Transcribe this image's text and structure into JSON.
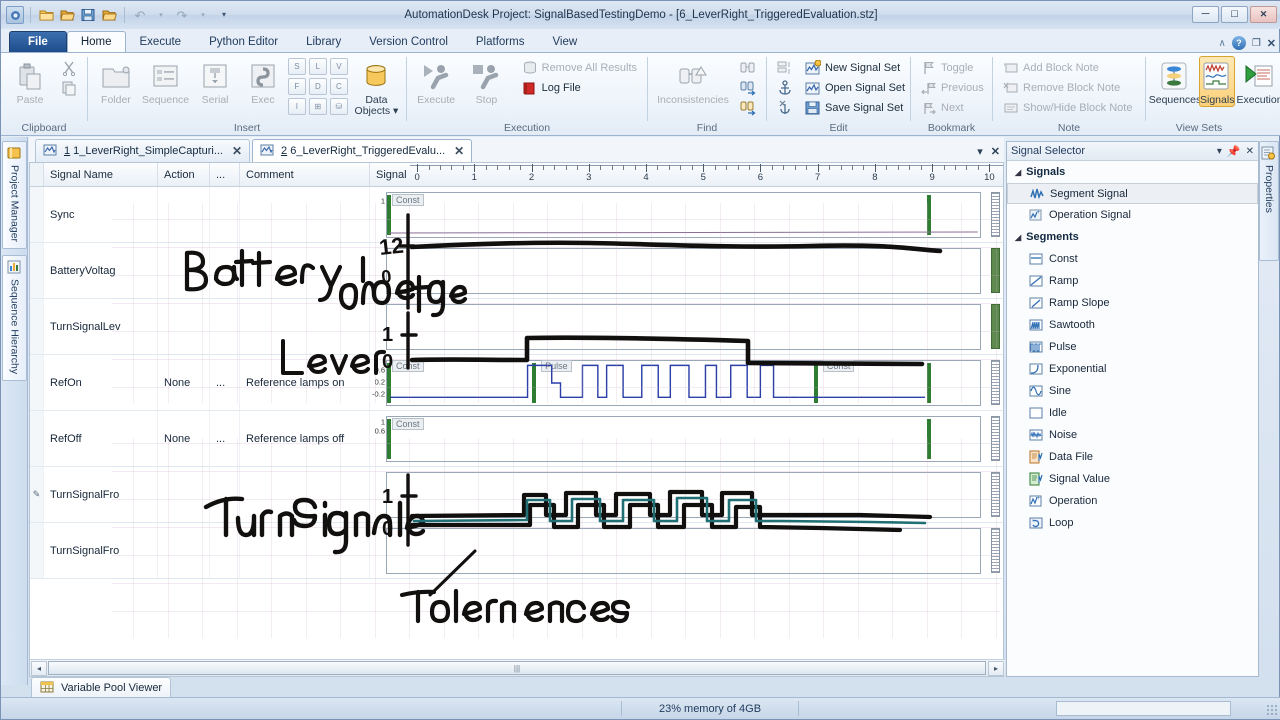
{
  "window": {
    "title": "AutomationDesk  Project: SignalBasedTestingDemo - [6_LeverRight_TriggeredEvaluation.stz]",
    "minimize": "—",
    "maximize": "□",
    "close": "✕"
  },
  "quick_access": {
    "items": [
      {
        "name": "app-menu-icon",
        "glyph": "⚙"
      },
      {
        "name": "new-project-icon",
        "glyph": "🖿"
      },
      {
        "name": "open-project-icon",
        "glyph": "📂"
      },
      {
        "name": "save-icon",
        "glyph": "💾"
      },
      {
        "name": "open-recent-icon",
        "glyph": "📁"
      },
      {
        "name": "undo-icon",
        "glyph": "↶"
      },
      {
        "name": "redo-icon",
        "glyph": "↷"
      },
      {
        "name": "customize-icon",
        "glyph": "▾"
      }
    ]
  },
  "ribbon_tabs": [
    {
      "label": "File",
      "active": false,
      "file": true
    },
    {
      "label": "Home",
      "active": true
    },
    {
      "label": "Execute",
      "active": false
    },
    {
      "label": "Python Editor",
      "active": false
    },
    {
      "label": "Library",
      "active": false
    },
    {
      "label": "Version Control",
      "active": false
    },
    {
      "label": "Platforms",
      "active": false
    },
    {
      "label": "View",
      "active": false
    }
  ],
  "ribbon_right": {
    "collapse": "∧",
    "help": "?",
    "restore": "❐",
    "close": "✕"
  },
  "ribbon": {
    "groups": [
      {
        "label": "Clipboard",
        "big": [
          {
            "label": "Paste",
            "icon": "paste-icon",
            "disabled": true
          }
        ],
        "small": [
          {
            "label": "",
            "icon": "cut-icon",
            "disabled": true
          },
          {
            "label": "",
            "icon": "copy-icon",
            "disabled": true
          }
        ]
      },
      {
        "label": "Insert",
        "big": [
          {
            "label": "Folder",
            "icon": "folder-icon",
            "disabled": true
          },
          {
            "label": "Sequence",
            "icon": "sequence-icon",
            "disabled": true
          },
          {
            "label": "Serial",
            "icon": "serial-icon",
            "disabled": true
          },
          {
            "label": "Exec",
            "icon": "exec-python-icon",
            "disabled": true
          }
        ],
        "mini": [
          "S",
          "L",
          "V",
          "F",
          "D",
          "C",
          "I",
          "⊞",
          "⛁"
        ],
        "big2": [
          {
            "label": "Data\nObjects ▾",
            "icon": "data-objects-icon",
            "disabled": false
          }
        ]
      },
      {
        "label": "Execution",
        "big": [
          {
            "label": "Execute",
            "icon": "execute-icon",
            "disabled": true
          },
          {
            "label": "Stop",
            "icon": "stop-icon",
            "disabled": true
          }
        ],
        "small": [
          {
            "label": "Remove All Results",
            "icon": "remove-results-icon",
            "disabled": true
          },
          {
            "label": "Log File",
            "icon": "log-file-icon",
            "disabled": false
          }
        ]
      },
      {
        "label": "Find",
        "big": [
          {
            "label": "Inconsistencies",
            "icon": "inconsistencies-icon",
            "disabled": true
          }
        ],
        "small": [
          {
            "label": "",
            "icon": "find-icon",
            "disabled": true
          },
          {
            "label": "",
            "icon": "find-next-icon",
            "disabled": false
          },
          {
            "label": "",
            "icon": "find-warning-icon",
            "disabled": false
          }
        ]
      },
      {
        "label": "Edit",
        "small": [
          {
            "label": "New Signal Set",
            "icon": "new-signal-set-icon",
            "disabled": false
          },
          {
            "label": "Open Signal Set",
            "icon": "open-signal-set-icon",
            "disabled": false
          },
          {
            "label": "Save Signal Set",
            "icon": "save-signal-set-icon",
            "disabled": false
          }
        ],
        "smallLeft": [
          {
            "label": "",
            "icon": "sort-icon",
            "disabled": true
          },
          {
            "label": "",
            "icon": "anchor-icon",
            "disabled": false
          },
          {
            "label": "",
            "icon": "anchor-cut-icon",
            "disabled": false
          }
        ]
      },
      {
        "label": "Bookmark",
        "small": [
          {
            "label": "Toggle",
            "icon": "flag-toggle-icon",
            "disabled": true
          },
          {
            "label": "Previous",
            "icon": "flag-previous-icon",
            "disabled": true
          },
          {
            "label": "Next",
            "icon": "flag-next-icon",
            "disabled": true
          }
        ]
      },
      {
        "label": "Note",
        "small": [
          {
            "label": "Add Block Note",
            "icon": "add-block-note-icon",
            "disabled": true
          },
          {
            "label": "Remove Block Note",
            "icon": "remove-block-note-icon",
            "disabled": true
          },
          {
            "label": "Show/Hide Block Note",
            "icon": "show-hide-block-note-icon",
            "disabled": true
          }
        ]
      },
      {
        "label": "View Sets",
        "big": [
          {
            "label": "Sequences",
            "icon": "sequences-view-icon",
            "disabled": false
          },
          {
            "label": "Signals",
            "icon": "signals-view-icon",
            "disabled": false,
            "selected": true
          },
          {
            "label": "Execution",
            "icon": "execution-view-icon",
            "disabled": false
          }
        ]
      }
    ]
  },
  "left_tabs": [
    {
      "label": "Project Manager",
      "icon": "project-manager-icon"
    },
    {
      "label": "Sequence Hierarchy",
      "icon": "sequence-hierarchy-icon"
    }
  ],
  "right_tab": {
    "label": "Properties",
    "icon": "properties-icon"
  },
  "document_tabs": [
    {
      "num": "1",
      "label": " 1_LeverRight_SimpleCapturi...",
      "active": false,
      "close": "✕"
    },
    {
      "num": "2",
      "label": " 6_LeverRight_TriggeredEvalu...",
      "active": true,
      "close": "✕"
    }
  ],
  "document_tabs_right": {
    "dropdown": "▾",
    "close": "✕"
  },
  "grid": {
    "columns": [
      {
        "key": "name",
        "label": "Signal Name"
      },
      {
        "key": "action",
        "label": "Action"
      },
      {
        "key": "dots",
        "label": "..."
      },
      {
        "key": "comment",
        "label": "Comment"
      },
      {
        "key": "signal",
        "label": "Signal"
      }
    ],
    "ruler_ticks": [
      "0",
      "1",
      "2",
      "3",
      "4",
      "5",
      "6",
      "7",
      "8",
      "9",
      "10"
    ],
    "rows": [
      {
        "name": "Sync",
        "action": "",
        "dots": "",
        "comment": "",
        "marker": "",
        "plot": {
          "segments": [
            "Const"
          ],
          "yticks": [
            "1"
          ],
          "scale_green": false,
          "marker_x": 0.91
        }
      },
      {
        "name": "BatteryVoltag",
        "action": "",
        "dots": "",
        "comment": "",
        "marker": "",
        "plot": {
          "segments": [],
          "yticks": [],
          "scale_green": true,
          "marker_x": null
        }
      },
      {
        "name": "TurnSignalLev",
        "action": "",
        "dots": "",
        "comment": "",
        "marker": "",
        "plot": {
          "segments": [],
          "yticks": [],
          "scale_green": true,
          "marker_x": null
        }
      },
      {
        "name": "RefOn",
        "action": "None",
        "dots": "...",
        "comment": "Reference lamps on",
        "marker": "",
        "plot": {
          "segments": [
            "Const",
            "Pulse",
            "Const"
          ],
          "yticks": [
            "0.6",
            "0.2",
            "-0.2"
          ],
          "scale_green": false,
          "marker_x": 0.91
        }
      },
      {
        "name": "RefOff",
        "action": "None",
        "dots": "...",
        "comment": "Reference lamps off",
        "marker": "",
        "plot": {
          "segments": [
            "Const"
          ],
          "yticks": [
            "1",
            "0.6"
          ],
          "scale_green": false,
          "marker_x": 0.91
        }
      },
      {
        "name": "TurnSignalFro",
        "action": "",
        "dots": "",
        "comment": "",
        "marker": "✎",
        "plot": {
          "segments": [],
          "yticks": [],
          "scale_green": false,
          "marker_x": null
        }
      },
      {
        "name": "TurnSignalFro",
        "action": "",
        "dots": "",
        "comment": "",
        "marker": "",
        "plot": {
          "segments": [],
          "yticks": [],
          "scale_green": false,
          "marker_x": null
        }
      }
    ],
    "hscroll": {
      "left_arrow": "◂",
      "thumb_grip": "|||"
    }
  },
  "sketch": {
    "labels": [
      "Battery",
      "Voltage",
      "Lever",
      "Turn Signal",
      "Tolerances"
    ],
    "axis_labels": [
      "12",
      "0",
      "1",
      "0",
      "1",
      "0"
    ]
  },
  "signal_selector": {
    "title": "Signal Selector",
    "buttons": {
      "dropdown": "▾",
      "pin": "⚓",
      "close": "✕"
    },
    "groups": [
      {
        "label": "Signals",
        "expander": "◢",
        "items": [
          {
            "label": "Segment Signal",
            "icon": "segment-signal-icon",
            "selected": true
          },
          {
            "label": "Operation Signal",
            "icon": "operation-signal-icon",
            "selected": false
          }
        ]
      },
      {
        "label": "Segments",
        "expander": "◢",
        "items": [
          {
            "label": "Const",
            "icon": "const-icon",
            "selected": false
          },
          {
            "label": "Ramp",
            "icon": "ramp-icon",
            "selected": false
          },
          {
            "label": "Ramp Slope",
            "icon": "ramp-slope-icon",
            "selected": false
          },
          {
            "label": "Sawtooth",
            "icon": "sawtooth-icon",
            "selected": false
          },
          {
            "label": "Pulse",
            "icon": "pulse-icon",
            "selected": false
          },
          {
            "label": "Exponential",
            "icon": "exponential-icon",
            "selected": false
          },
          {
            "label": "Sine",
            "icon": "sine-icon",
            "selected": false
          },
          {
            "label": "Idle",
            "icon": "idle-icon",
            "selected": false
          },
          {
            "label": "Noise",
            "icon": "noise-icon",
            "selected": false
          },
          {
            "label": "Data File",
            "icon": "data-file-icon",
            "selected": false
          },
          {
            "label": "Signal Value",
            "icon": "signal-value-icon",
            "selected": false
          },
          {
            "label": "Operation",
            "icon": "operation-icon",
            "selected": false
          },
          {
            "label": "Loop",
            "icon": "loop-icon",
            "selected": false
          }
        ]
      }
    ]
  },
  "bottom": {
    "variable_pool_viewer": "Variable Pool Viewer"
  },
  "statusbar": {
    "memory": "23% memory of 4GB"
  },
  "colors": {
    "accent_blue": "#1f4d8c",
    "selected_gold": "#fbd078",
    "signal_blue": "#2b3fa8",
    "marker_green": "#2f7d32",
    "sketch_teal": "#1f6f74"
  }
}
